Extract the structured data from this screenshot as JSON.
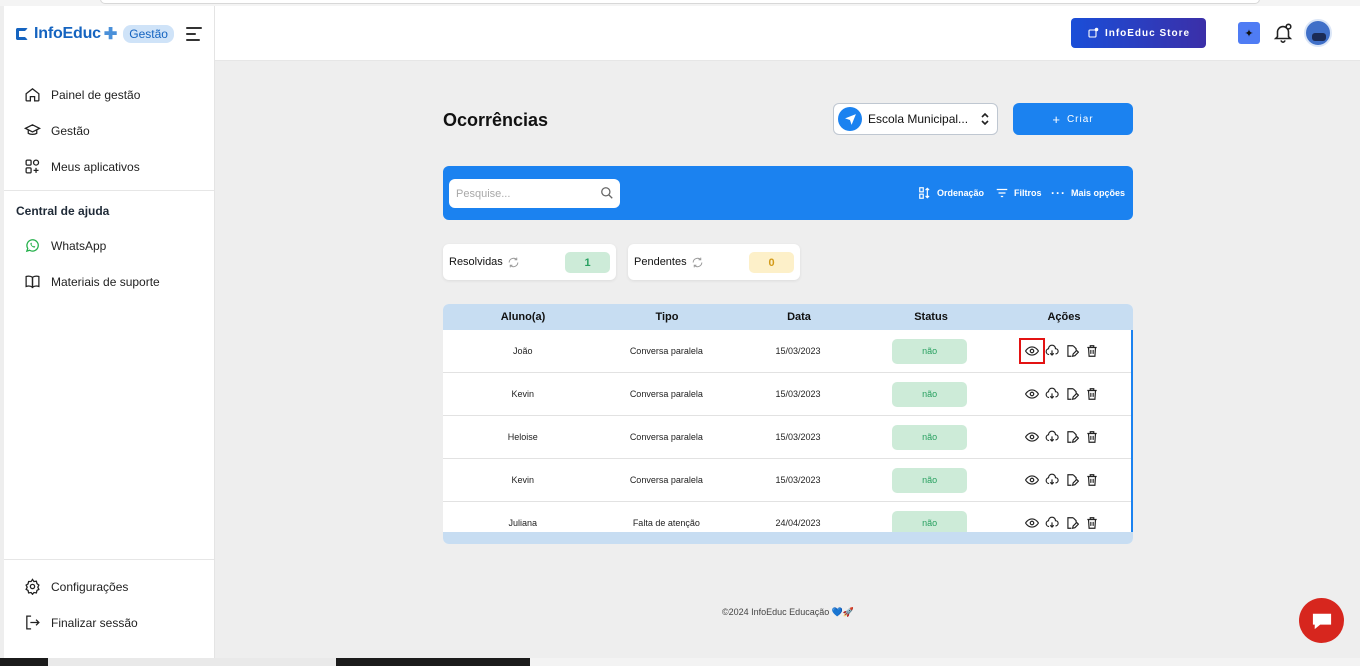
{
  "brand": {
    "name": "InfoEduc",
    "badge": "Gestão"
  },
  "sidebar": {
    "nav": [
      {
        "label": "Painel de gestão",
        "icon": "home-icon"
      },
      {
        "label": "Gestão",
        "icon": "graduation-cap-icon"
      },
      {
        "label": "Meus aplicativos",
        "icon": "apps-icon"
      }
    ],
    "help_title": "Central de ajuda",
    "help": [
      {
        "label": "WhatsApp",
        "icon": "whatsapp-icon"
      },
      {
        "label": "Materiais de suporte",
        "icon": "book-icon"
      }
    ],
    "bottom": [
      {
        "label": "Configurações",
        "icon": "gear-icon"
      },
      {
        "label": "Finalizar sessão",
        "icon": "logout-icon"
      }
    ]
  },
  "topbar": {
    "store_label": "InfoEduc Store"
  },
  "page": {
    "title": "Ocorrências",
    "school_select": "Escola Municipal...",
    "create_label": "Criar",
    "search_placeholder": "Pesquise...",
    "toolbar": {
      "sort": "Ordenação",
      "filters": "Filtros",
      "more": "Mais opções"
    }
  },
  "stats": {
    "resolved": {
      "label": "Resolvidas",
      "count": "1",
      "color": "#cdebd8",
      "text_color": "#28a060"
    },
    "pending": {
      "label": "Pendentes",
      "count": "0",
      "color": "#fdf0c9",
      "text_color": "#d39a18"
    }
  },
  "table": {
    "headers": [
      "Aluno(a)",
      "Tipo",
      "Data",
      "Status",
      "Ações"
    ],
    "rows": [
      {
        "aluno": "João",
        "tipo": "Conversa paralela",
        "data": "15/03/2023",
        "status": "não"
      },
      {
        "aluno": "Kevin",
        "tipo": "Conversa paralela",
        "data": "15/03/2023",
        "status": "não"
      },
      {
        "aluno": "Heloise",
        "tipo": "Conversa paralela",
        "data": "15/03/2023",
        "status": "não"
      },
      {
        "aluno": "Kevin",
        "tipo": "Conversa paralela",
        "data": "15/03/2023",
        "status": "não"
      },
      {
        "aluno": "Juliana",
        "tipo": "Falta de atenção",
        "data": "24/04/2023",
        "status": "não"
      }
    ]
  },
  "footer": "©2024 InfoEduc Educação 💙🚀",
  "colors": {
    "primary": "#1b82f0",
    "brand": "#1564c0",
    "chat": "#d7261e"
  }
}
